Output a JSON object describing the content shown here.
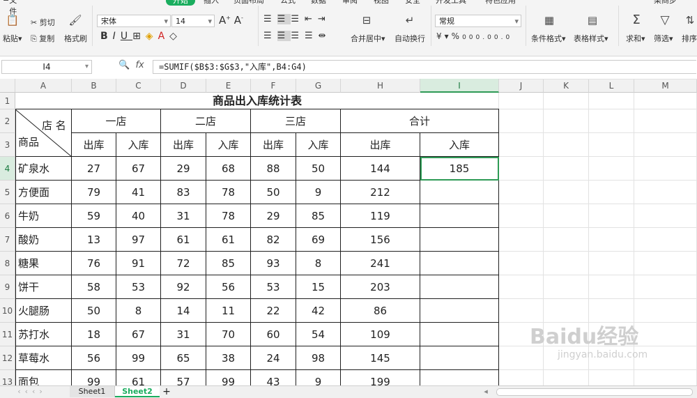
{
  "ribbon": {
    "menu_label": "文件",
    "tabs": [
      "开始",
      "插入",
      "页面布局",
      "公式",
      "数据",
      "审阅",
      "视图",
      "安全",
      "开发工具",
      "特色应用"
    ],
    "active_tab": "开始",
    "user": "某商步",
    "clipboard": {
      "cut": "剪切",
      "copy": "复制",
      "paste": "粘贴",
      "format_painter": "格式刷"
    },
    "font_name": "宋体",
    "font_size": "14",
    "number_format": "常规",
    "merge_center": "合并居中",
    "wrap_text": "自动换行",
    "conditional_format": "条件格式",
    "table_style": "表格样式",
    "sum": "求和",
    "filter": "筛选",
    "sort": "排序"
  },
  "formula_bar": {
    "name_box": "I4",
    "formula": "=SUMIF($B$3:$G$3,\"入库\",B4:G4)"
  },
  "columns": [
    "A",
    "B",
    "C",
    "D",
    "E",
    "F",
    "G",
    "H",
    "I",
    "J",
    "K",
    "L",
    "M"
  ],
  "active_column": "I",
  "rows": [
    "1",
    "2",
    "3",
    "4",
    "5",
    "6",
    "7",
    "8",
    "9",
    "10",
    "11",
    "12",
    "13"
  ],
  "active_row": "4",
  "table": {
    "title": "商品出入库统计表",
    "corner_top": "店 名",
    "corner_bottom": "商品",
    "stores": [
      "一店",
      "二店",
      "三店",
      "合计"
    ],
    "out_label": "出库",
    "in_label": "入库",
    "items": [
      {
        "name": "矿泉水",
        "v": [
          "27",
          "67",
          "29",
          "68",
          "88",
          "50",
          "144",
          "185"
        ]
      },
      {
        "name": "方便面",
        "v": [
          "79",
          "41",
          "83",
          "78",
          "50",
          "9",
          "212",
          ""
        ]
      },
      {
        "name": "牛奶",
        "v": [
          "59",
          "40",
          "31",
          "78",
          "29",
          "85",
          "119",
          ""
        ]
      },
      {
        "name": "酸奶",
        "v": [
          "13",
          "97",
          "61",
          "61",
          "82",
          "69",
          "156",
          ""
        ]
      },
      {
        "name": "糖果",
        "v": [
          "76",
          "91",
          "72",
          "85",
          "93",
          "8",
          "241",
          ""
        ]
      },
      {
        "name": "饼干",
        "v": [
          "58",
          "53",
          "92",
          "56",
          "53",
          "15",
          "203",
          ""
        ]
      },
      {
        "name": "火腿肠",
        "v": [
          "50",
          "8",
          "14",
          "11",
          "22",
          "42",
          "86",
          ""
        ]
      },
      {
        "name": "苏打水",
        "v": [
          "18",
          "67",
          "31",
          "70",
          "60",
          "54",
          "109",
          ""
        ]
      },
      {
        "name": "草莓水",
        "v": [
          "56",
          "99",
          "65",
          "38",
          "24",
          "98",
          "145",
          ""
        ]
      },
      {
        "name": "面包",
        "v": [
          "99",
          "61",
          "57",
          "99",
          "43",
          "9",
          "199",
          ""
        ]
      }
    ]
  },
  "sheets": [
    "Sheet1",
    "Sheet2"
  ],
  "active_sheet": "Sheet2",
  "watermark": "Baidu经验 jingyan.baidu.com"
}
